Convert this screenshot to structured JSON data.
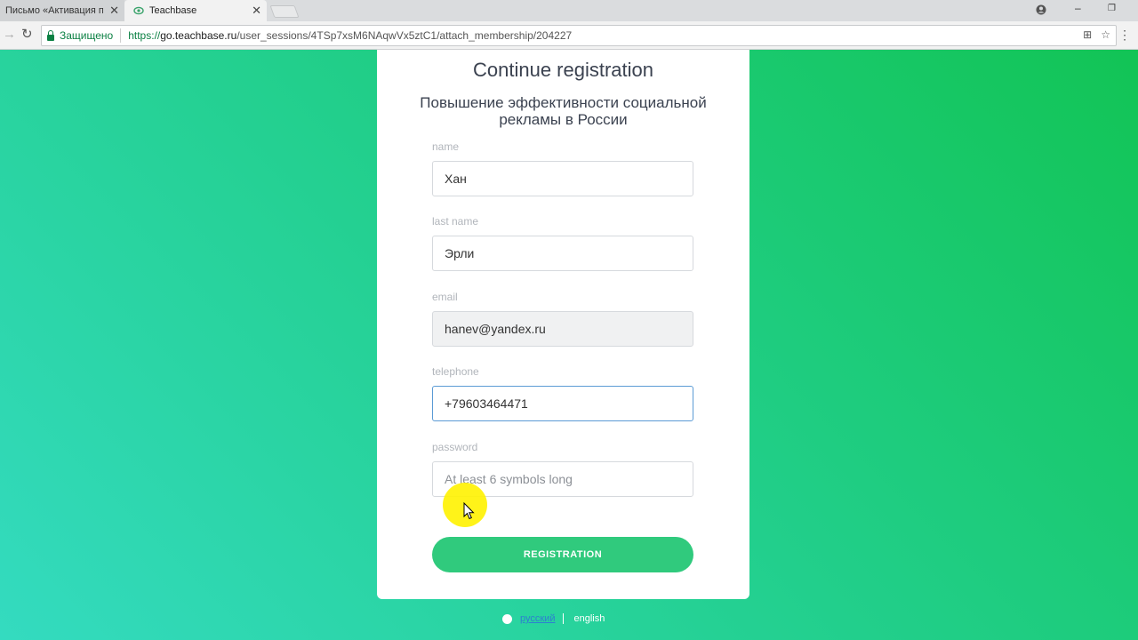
{
  "browser": {
    "tabs": [
      {
        "title": "Письмо «Активация по"
      },
      {
        "title": "Teachbase"
      }
    ],
    "secure_label": "Защищено",
    "url_scheme": "https://",
    "url_host": "go.teachbase.ru",
    "url_path": "/user_sessions/4TSp7xsM6NAqwVx5ztC1/attach_membership/204227"
  },
  "form": {
    "title": "Continue registration",
    "course": "Повышение эффективности социальной рекламы в России",
    "fields": [
      {
        "label": "name",
        "value": "Хан"
      },
      {
        "label": "last name",
        "value": "Эрли"
      },
      {
        "label": "email",
        "value": "hanev@yandex.ru"
      },
      {
        "label": "telephone",
        "value": "+79603464471"
      },
      {
        "label": "password",
        "placeholder": "At least 6 symbols long"
      }
    ],
    "submit_label": "REGISTRATION"
  },
  "languages": {
    "ru": "русский",
    "en": "english"
  },
  "colors": {
    "accent": "#30ca7d",
    "background_start": "#34dbc0",
    "background_end": "#12c455"
  }
}
